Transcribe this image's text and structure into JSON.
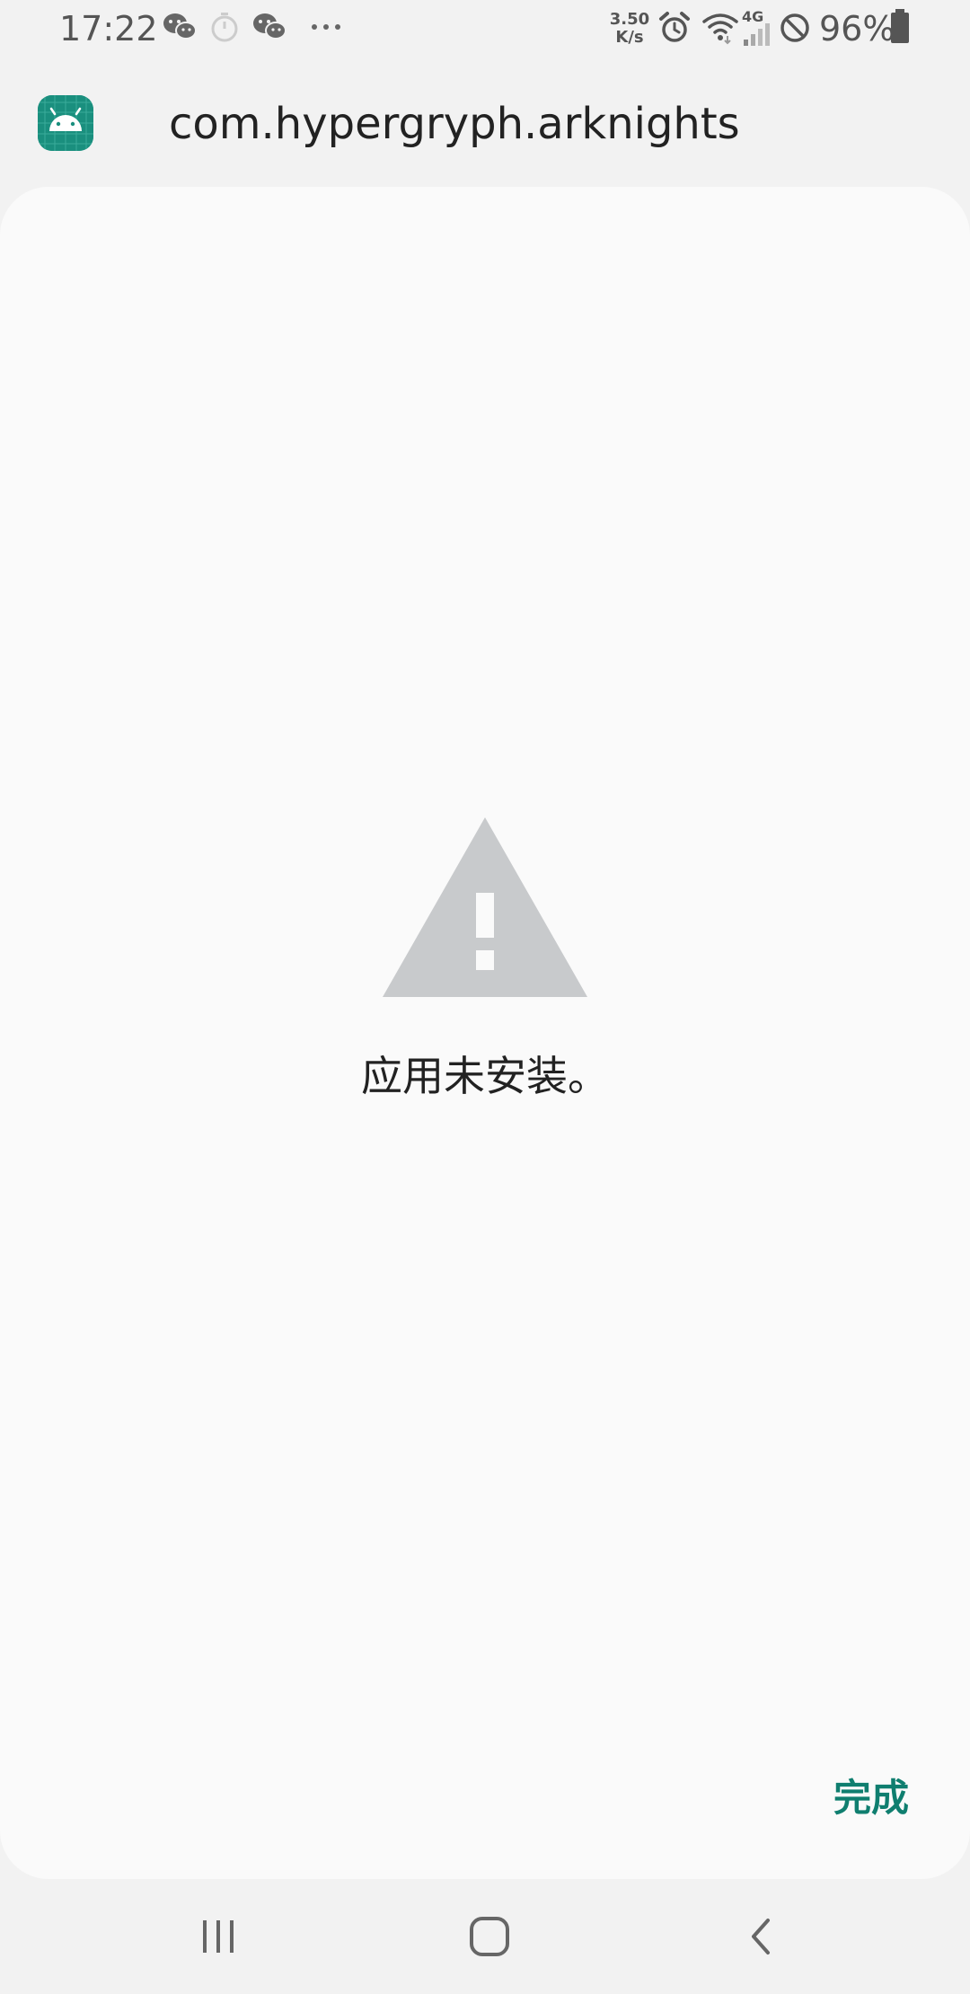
{
  "status_bar": {
    "time": "17:22",
    "net_speed_value": "3.50",
    "net_speed_unit": "K/s",
    "network_type": "4G",
    "battery_percent": "96%",
    "icons": [
      "wechat-icon",
      "timer-icon",
      "wechat-icon",
      "more-dots-icon",
      "alarm-icon",
      "wifi-icon",
      "signal-icon",
      "do-not-disturb-icon",
      "battery-icon"
    ]
  },
  "header": {
    "package_name": "com.hypergryph.arknights",
    "icon": "android-icon"
  },
  "dialog": {
    "message": "应用未安装。",
    "icon": "warning-icon",
    "done_label": "完成"
  },
  "nav": {
    "recents": "recents-icon",
    "home": "home-icon",
    "back": "back-icon"
  },
  "colors": {
    "accent": "#0f7e6f",
    "app_icon_bg": "#1a8f7e",
    "warning_icon": "#c8cacc",
    "background": "#f2f2f2",
    "card": "#fafafa"
  }
}
